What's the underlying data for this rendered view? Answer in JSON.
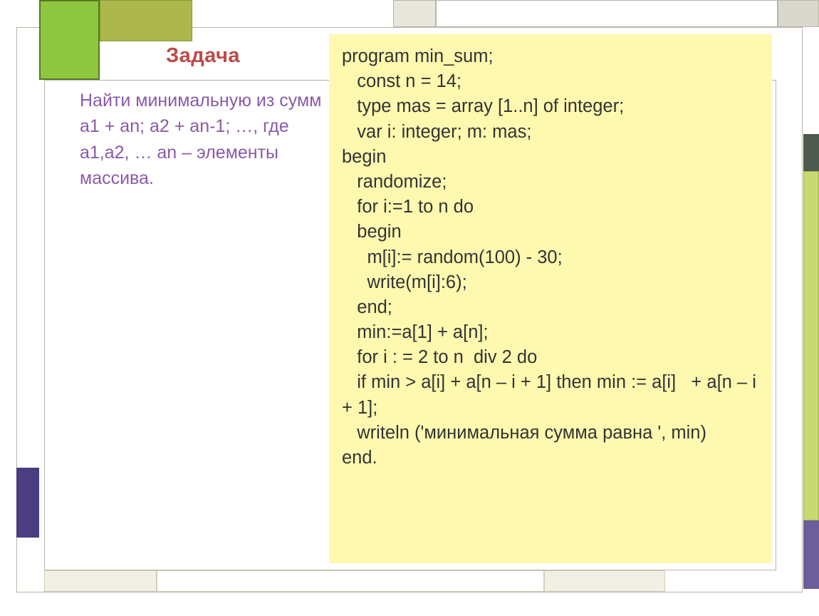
{
  "task": {
    "title": "Задача",
    "line1": "Найти минимальную из сумм",
    "line2": "a1 + an; a2 + an-1; …, где a1,a2, … an – элементы массива."
  },
  "code": {
    "l01": "program min_sum;",
    "l02": "   const n = 14;",
    "l03": "   type mas = array [1..n] of integer;",
    "l04": "   var i: integer; m: mas;",
    "l05": "begin",
    "l06": "   randomize;",
    "l07": "   for i:=1 to n do",
    "l08": "   begin",
    "l09": "     m[i]:= random(100) - 30;",
    "l10": "     write(m[i]:6);",
    "l11": "   end;",
    "l12": "   min:=a[1] + a[n];",
    "l13": "   for i : = 2 to n  div 2 do",
    "l14": "   if min > a[i] + a[n – i + 1] then min := a[i]   + a[n – i + 1];",
    "l15": "   writeln ('минимальная сумма равна ', min)",
    "l16": "end."
  }
}
